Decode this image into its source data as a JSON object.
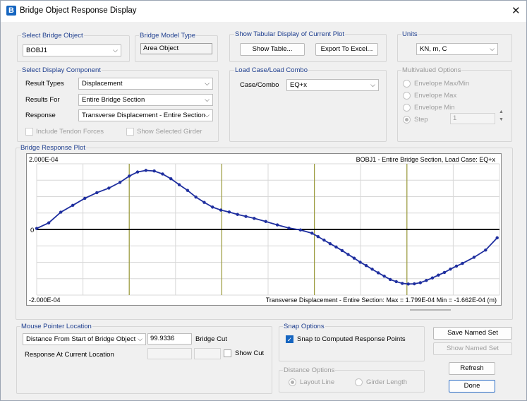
{
  "window": {
    "title": "Bridge Object Response Display"
  },
  "bridge_object": {
    "title": "Select Bridge Object",
    "value": "BOBJ1"
  },
  "model_type": {
    "title": "Bridge Model Type",
    "value": "Area Object"
  },
  "tabular": {
    "title": "Show Tabular Display of Current Plot",
    "show_table": "Show Table...",
    "export_excel": "Export To Excel..."
  },
  "units": {
    "title": "Units",
    "value": "KN, m, C"
  },
  "display_component": {
    "title": "Select Display Component",
    "result_types_label": "Result Types",
    "result_types_value": "Displacement",
    "results_for_label": "Results For",
    "results_for_value": "Entire Bridge Section",
    "response_label": "Response",
    "response_value": "Transverse Displacement - Entire Section",
    "include_tendon": "Include Tendon Forces",
    "show_girder": "Show Selected Girder"
  },
  "load_case": {
    "title": "Load Case/Load Combo",
    "label": "Case/Combo",
    "value": "EQ+x"
  },
  "multivalued": {
    "title": "Multivalued Options",
    "options": [
      "Envelope Max/Min",
      "Envelope Max",
      "Envelope Min",
      "Step"
    ],
    "step_value": "1"
  },
  "plot": {
    "title": "Bridge Response Plot"
  },
  "chart_data": {
    "type": "line",
    "title": "BOBJ1 - Entire Bridge Section,  Load Case: EQ+x",
    "ymax_label": "2.000E-04",
    "ymin_label": "-2.000E-04",
    "zero_label": "0",
    "footer": "Transverse Displacement - Entire Section:  Max = 1.799E-04   Min = -1.662E-04  (m)",
    "x_range": [
      0,
      100
    ],
    "ylim": [
      -0.0002,
      0.0002
    ],
    "grid": true,
    "vertical_markers_x": [
      20,
      40,
      60,
      80
    ],
    "series": [
      {
        "color": "#1f2f9f",
        "x": [
          0,
          2.6,
          5.2,
          7.8,
          10.4,
          13,
          15.6,
          18,
          20,
          21.8,
          23.6,
          25.4,
          27.2,
          29,
          30.8,
          32.6,
          34.4,
          36.2,
          38,
          39.8,
          41.6,
          43.4,
          45.2,
          47,
          49.5,
          52,
          54.5,
          57,
          59.5,
          60.8,
          62.1,
          63.4,
          64.7,
          66,
          67.3,
          68.6,
          69.9,
          71.2,
          72.5,
          73.8,
          75.1,
          76.4,
          77.7,
          79,
          80.3,
          81.6,
          82.9,
          84.2,
          85.5,
          86.8,
          88.1,
          89.4,
          90.7,
          92,
          94.5,
          97,
          99.5
        ],
        "y": [
          2.98e-06,
          2e-05,
          5.25e-05,
          7.35e-05,
          9.47e-05,
          0.000112,
          0.000126,
          0.0001435,
          0.0001625,
          0.000175,
          0.0001799,
          0.000178,
          0.000169,
          0.0001545,
          0.0001362,
          0.000119,
          9.85e-05,
          8.25e-05,
          6.8e-05,
          5.9e-05,
          5.3e-05,
          4.57e-05,
          3.97e-05,
          3.38e-05,
          2.42e-05,
          1.38e-05,
          4.2e-06,
          -1.5e-06,
          -1.15e-05,
          -2.2e-05,
          -3.25e-05,
          -4.34e-05,
          -5.34e-05,
          -6.44e-05,
          -7.62e-05,
          -8.74e-05,
          -9.98e-05,
          -0.0001101,
          -0.0001212,
          -0.0001322,
          -0.0001424,
          -0.0001526,
          -0.000159,
          -0.0001643,
          -0.0001662,
          -0.0001656,
          -0.0001622,
          -0.0001553,
          -0.0001478,
          -0.0001391,
          -0.0001311,
          -0.0001209,
          -0.0001118,
          -0.0001034,
          -8.49e-05,
          -6.28e-05,
          -2.55e-05
        ]
      }
    ]
  },
  "mouse_pointer": {
    "title": "Mouse Pointer Location",
    "distance_value": "Distance From Start of Bridge Object",
    "distance_number": "99.9336",
    "bridge_cut": "Bridge Cut",
    "response_at": "Response At Current Location",
    "show_cut": "Show Cut"
  },
  "snap": {
    "title": "Snap Options",
    "snap_label": "Snap to Computed Response Points"
  },
  "distance_options": {
    "title": "Distance Options",
    "layout_line": "Layout Line",
    "girder_length": "Girder Length"
  },
  "buttons": {
    "save_named_set": "Save Named Set",
    "show_named_set": "Show Named Set",
    "refresh": "Refresh",
    "done": "Done"
  }
}
